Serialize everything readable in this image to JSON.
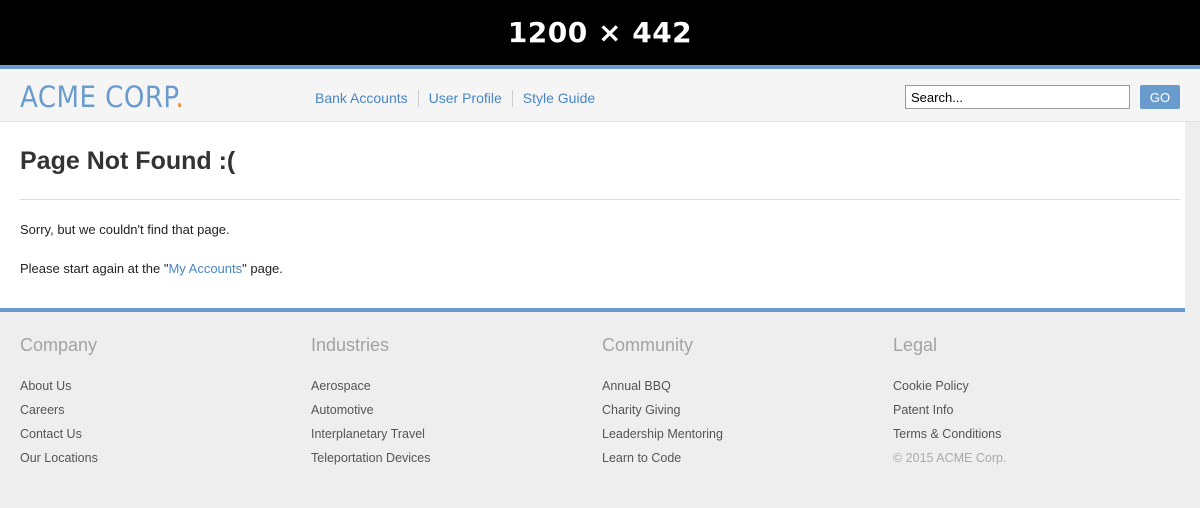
{
  "banner": {
    "text": "1200 × 442"
  },
  "header": {
    "logo_text": "ACME CORP",
    "logo_dot": ".",
    "nav": [
      "Bank Accounts",
      "User Profile",
      "Style Guide"
    ],
    "search_placeholder": "Search...",
    "go_label": "GO"
  },
  "main": {
    "title": "Page Not Found :(",
    "message1": "Sorry, but we couldn't find that page.",
    "message2_pre": "Please start again at the \"",
    "message2_link": "My Accounts",
    "message2_post": "\" page."
  },
  "footer": {
    "columns": [
      {
        "title": "Company",
        "links": [
          "About Us",
          "Careers",
          "Contact Us",
          "Our Locations"
        ]
      },
      {
        "title": "Industries",
        "links": [
          "Aerospace",
          "Automotive",
          "Interplanetary Travel",
          "Teleportation Devices"
        ]
      },
      {
        "title": "Community",
        "links": [
          "Annual BBQ",
          "Charity Giving",
          "Leadership Mentoring",
          "Learn to Code"
        ]
      },
      {
        "title": "Legal",
        "links": [
          "Cookie Policy",
          "Patent Info",
          "Terms & Conditions"
        ]
      }
    ],
    "copyright": "© 2015 ACME Corp."
  },
  "colors": {
    "accent": "#6a9bcd",
    "logo_dot": "#f08a3c",
    "link": "#4a86c4"
  }
}
